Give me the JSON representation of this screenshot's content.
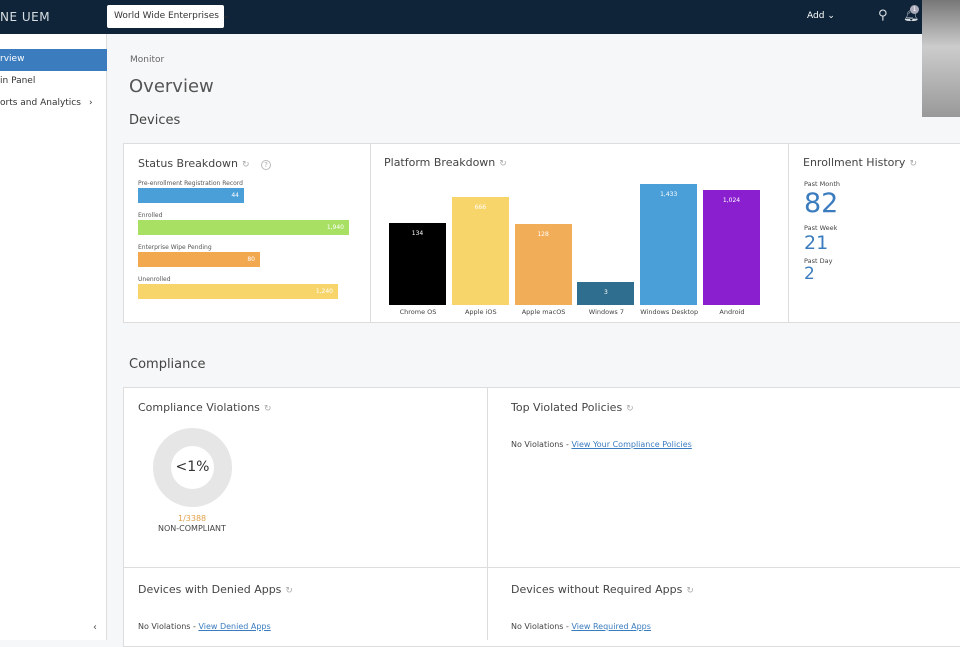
{
  "header": {
    "brand": "NE UEM",
    "org": "World Wide Enterprises",
    "add": "Add",
    "notification_count": "1"
  },
  "sidebar": {
    "items": [
      {
        "label": "rview",
        "active": true
      },
      {
        "label": "in Panel"
      },
      {
        "label": "orts and Analytics"
      }
    ]
  },
  "page": {
    "breadcrumb": "Monitor",
    "title": "Overview",
    "devices_heading": "Devices",
    "compliance_heading": "Compliance"
  },
  "status": {
    "title": "Status Breakdown",
    "bars": [
      {
        "label": "Pre-enrollment Registration Record",
        "value": "44",
        "color": "#4a9fd8",
        "fill": 0.5
      },
      {
        "label": "Enrolled",
        "value": "1,940",
        "color": "#a8e063",
        "fill": 1.0
      },
      {
        "label": "Enterprise Wipe Pending",
        "value": "80",
        "color": "#f2a84f",
        "fill": 0.58
      },
      {
        "label": "Unenrolled",
        "value": "1,240",
        "color": "#f7d56a",
        "fill": 0.95
      }
    ]
  },
  "chart_data": {
    "type": "bar",
    "title": "Platform Breakdown",
    "categories": [
      "Chrome OS",
      "Apple iOS",
      "Apple macOS",
      "Windows 7",
      "Windows Desktop",
      "Android"
    ],
    "values": [
      134,
      666,
      128,
      3,
      1433,
      1024
    ],
    "value_labels": [
      "134",
      "666",
      "128",
      "3",
      "1,433",
      "1,024"
    ],
    "colors": [
      "#000000",
      "#f7d56a",
      "#f2ad58",
      "#2f6e8e",
      "#4a9fd8",
      "#8a1fd0"
    ]
  },
  "enrollment": {
    "title": "Enrollment History",
    "items": [
      {
        "label": "Past Month",
        "value": "82"
      },
      {
        "label": "Past Week",
        "value": "21"
      },
      {
        "label": "Past Day",
        "value": "2"
      }
    ]
  },
  "compliance": {
    "violations_title": "Compliance Violations",
    "percent": "<1%",
    "ratio": "1/3388",
    "status": "NON-COMPLIANT",
    "top_title": "Top Violated Policies",
    "top_text": "No Violations - ",
    "top_link": "View Your Compliance Policies",
    "denied_title": "Devices with Denied Apps",
    "denied_text": "No Violations - ",
    "denied_link": "View Denied Apps",
    "required_title": "Devices without Required Apps",
    "required_text": "No Violations - ",
    "required_link": "View Required Apps"
  }
}
